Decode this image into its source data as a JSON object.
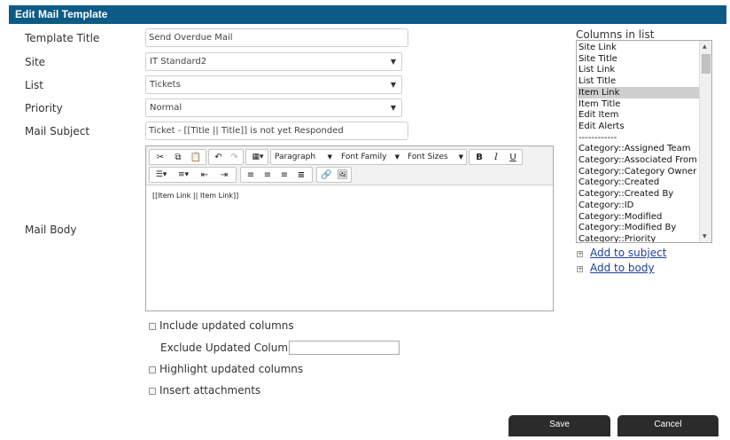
{
  "window": {
    "title": "Edit Mail Template"
  },
  "form": {
    "template_title": {
      "label": "Template Title",
      "value": "Send Overdue Mail"
    },
    "site": {
      "label": "Site",
      "value": "IT Standard2"
    },
    "list": {
      "label": "List",
      "value": "Tickets"
    },
    "priority": {
      "label": "Priority",
      "value": "Normal"
    },
    "mail_subject": {
      "label": "Mail Subject",
      "value": "Ticket - [[Title || Title]] is not yet Responded"
    },
    "mail_body": {
      "label": "Mail Body",
      "content": "[[Item Link || Item Link]]"
    }
  },
  "toolbar": {
    "paragraph": "Paragraph",
    "font_family": "Font Family",
    "font_sizes": "Font Sizes",
    "bold": "B",
    "italic": "I",
    "underline": "U"
  },
  "columns": {
    "label": "Columns in list",
    "items": [
      "Site Link",
      "Site Title",
      "List Link",
      "List Title",
      "Item Link",
      "Item Title",
      "Edit Item",
      "Edit Alerts",
      "------------",
      "Category::Assigned Team",
      "Category::Associated From Em",
      "Category::Category Owner",
      "Category::Created",
      "Category::Created By",
      "Category::ID",
      "Category::Modified",
      "Category::Modified By",
      "Category::Priority"
    ],
    "selected_index": 4,
    "add_to_subject": "Add to subject",
    "add_to_body": "Add to body"
  },
  "options": {
    "include_updated": "Include updated columns",
    "exclude_updated_label": "Exclude Updated Columns",
    "exclude_updated_value": "",
    "highlight_updated": "Highlight updated columns",
    "insert_attachments": "Insert attachments"
  },
  "actions": {
    "save": "Save",
    "cancel": "Cancel"
  },
  "colors": {
    "titlebar": "#0b5b85",
    "button": "#2b2b2b",
    "link": "#1e3f9e"
  }
}
